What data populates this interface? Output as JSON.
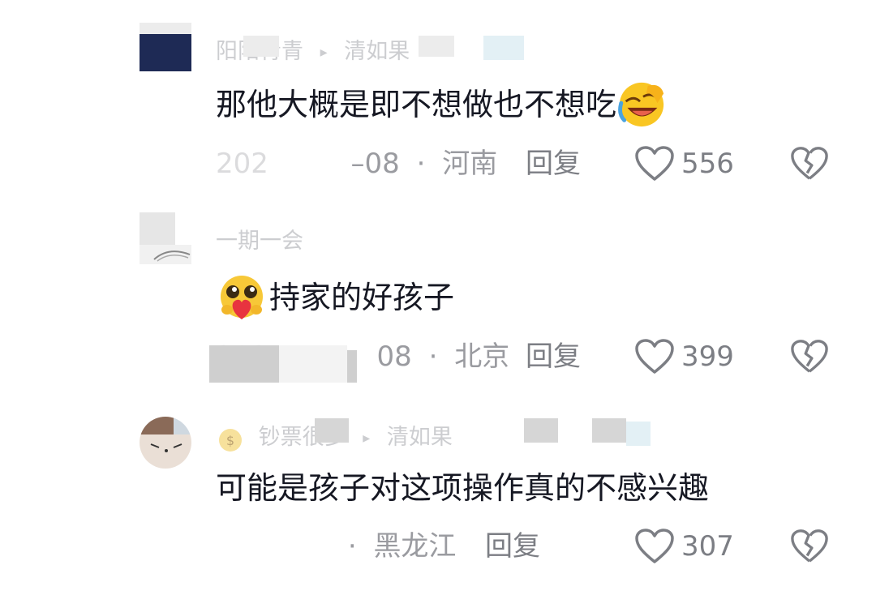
{
  "comments": [
    {
      "username": "阳阳青青",
      "reply_to": "清如果",
      "text": "那他大概是即不想做也不想吃",
      "emoji": "laughing-crying-emoji",
      "date": "2023-11-08",
      "date_visible": "–08",
      "date_prefix_blur": "202",
      "location": "河南",
      "reply_label": "回复",
      "likes": "556"
    },
    {
      "username": "一期一会",
      "text": "持家的好孩子",
      "emoji": "heart-hug-emoji",
      "date_visible": "08",
      "date_prefix_blur": "202",
      "location": "北京",
      "reply_label": "回复",
      "likes": "399"
    },
    {
      "username": "钞票很多",
      "reply_to": "清如果",
      "badge": "money-bag-icon",
      "text": "可能是孩子对这项操作真的不感兴趣",
      "location": "黑龙江",
      "reply_label": "回复",
      "likes": "307"
    }
  ],
  "icons": {
    "like": "heart-outline-icon",
    "dislike": "broken-heart-icon"
  },
  "colors": {
    "text_primary": "#161823",
    "text_secondary": "#9a9ba0",
    "action_gray": "#7c7e84"
  }
}
